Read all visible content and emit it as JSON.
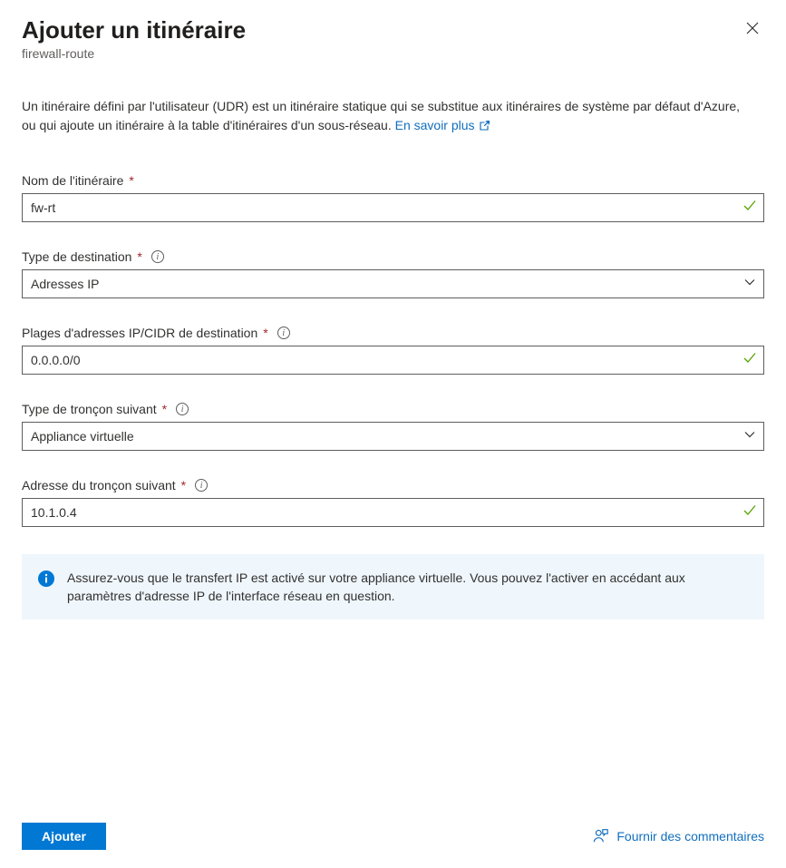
{
  "header": {
    "title": "Ajouter un itinéraire",
    "subtitle": "firewall-route"
  },
  "description": {
    "text": "Un itinéraire défini par l'utilisateur (UDR) est un itinéraire statique qui se substitue aux itinéraires de système par défaut d'Azure, ou qui ajoute un itinéraire à la table d'itinéraires d'un sous-réseau. ",
    "link_label": "En savoir plus"
  },
  "fields": {
    "route_name": {
      "label": "Nom de l'itinéraire",
      "value": "fw-rt"
    },
    "dest_type": {
      "label": "Type de destination",
      "value": "Adresses IP"
    },
    "cidr": {
      "label": "Plages d'adresses IP/CIDR de destination",
      "value": "0.0.0.0/0"
    },
    "next_hop_type": {
      "label": "Type de tronçon suivant",
      "value": "Appliance virtuelle"
    },
    "next_hop_addr": {
      "label": "Adresse du tronçon suivant",
      "value": "10.1.0.4"
    }
  },
  "info_box": {
    "text": "Assurez-vous que le transfert IP est activé sur votre appliance virtuelle. Vous pouvez l'activer en accédant aux paramètres d'adresse IP de l'interface réseau en question."
  },
  "footer": {
    "add_label": "Ajouter",
    "feedback_label": "Fournir des commentaires"
  }
}
